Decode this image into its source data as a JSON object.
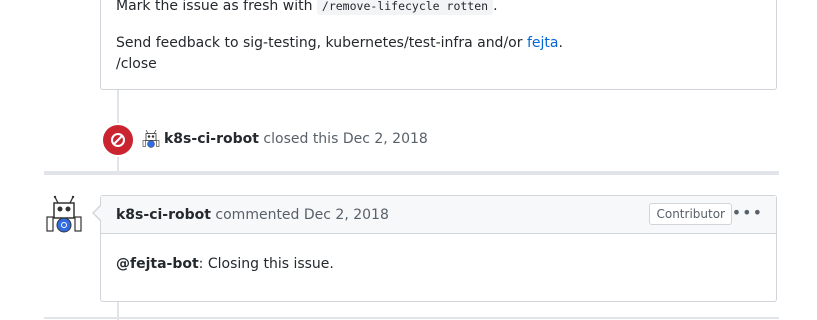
{
  "top_comment": {
    "line1_prefix": "Mark the issue as fresh with",
    "line1_code": "/remove-lifecycle rotten",
    "line1_suffix": ".",
    "line2_prefix": "Send feedback to sig-testing, kubernetes/test-infra and/or",
    "line2_link": "fejta",
    "line2_suffix": ".",
    "line3": "/close"
  },
  "close_event": {
    "icon": "circle-slash-icon",
    "author": "k8s-ci-robot",
    "action": "closed this",
    "date": "Dec 2, 2018"
  },
  "comment": {
    "author": "k8s-ci-robot",
    "action": "commented",
    "date": "Dec 2, 2018",
    "role_badge": "Contributor",
    "menu_icon": "kebab-horizontal-icon",
    "body_mention": "@fejta-bot",
    "body_text": ": Closing this issue."
  },
  "colors": {
    "closed_red": "#cb2431",
    "link_blue": "#0366d6",
    "border": "#d1d5da",
    "header_bg": "#f6f8fa"
  }
}
